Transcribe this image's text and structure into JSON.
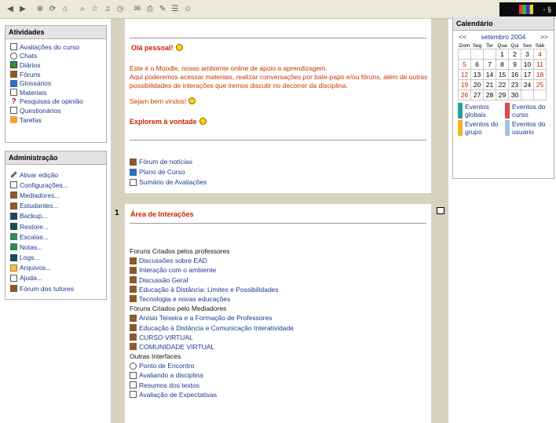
{
  "window_corner": {
    "controls": "- §"
  },
  "activities": {
    "title": "Atividades",
    "items": [
      {
        "label": "Avaliações do curso",
        "icon": "document-icon"
      },
      {
        "label": "Chats",
        "icon": "chat-icon"
      },
      {
        "label": "Diários",
        "icon": "diary-icon"
      },
      {
        "label": "Fóruns",
        "icon": "forum-icon"
      },
      {
        "label": "Glossários",
        "icon": "glossary-icon"
      },
      {
        "label": "Materiais",
        "icon": "material-icon"
      },
      {
        "label": "Pesquisas de opinião",
        "icon": "question-icon"
      },
      {
        "label": "Questionários",
        "icon": "quiz-icon"
      },
      {
        "label": "Tarefas",
        "icon": "task-icon"
      }
    ]
  },
  "admin": {
    "title": "Administração",
    "items": [
      {
        "label": "Ativar edição",
        "icon": "pen-icon"
      },
      {
        "label": "Configurações...",
        "icon": "settings-icon"
      },
      {
        "label": "Mediadores...",
        "icon": "users-icon"
      },
      {
        "label": "Estudantes...",
        "icon": "users-icon"
      },
      {
        "label": "Backup...",
        "icon": "backup-icon"
      },
      {
        "label": "Restore...",
        "icon": "restore-icon"
      },
      {
        "label": "Escalas...",
        "icon": "scales-icon"
      },
      {
        "label": "Notas...",
        "icon": "grades-icon"
      },
      {
        "label": "Logs...",
        "icon": "logs-icon"
      },
      {
        "label": "Arquivos...",
        "icon": "folder-icon"
      },
      {
        "label": "Ajuda...",
        "icon": "help-icon"
      },
      {
        "label": "Fórum dos tutores",
        "icon": "forum-icon"
      }
    ]
  },
  "intro": {
    "greeting": "Olá pessoal!",
    "paragraph1": "Este é o Moodle, nosso ambiente online de apoio a aprendizagem.",
    "paragraph2": "Aqui poderemos acessar materiais, realizar conversações por bate-papo e/ou fóruns, além de outras possibilidades de interações que iremos discutir no decorrer da disciplina.",
    "welcome": "Sejam bem vindos!",
    "explore": "Explorem à vontade",
    "links": [
      "Fórum de notícias",
      "Plano de Curso",
      "Sumário de Avaliações"
    ]
  },
  "section1": {
    "number": "1",
    "title": "Área de Interações",
    "group1_label": "Foruns Criados pelos professores",
    "group1": [
      "Discussões sobre EAD",
      "Interação com o ambiente",
      "Discussão Geral",
      "Educação à Distância: Limites e Possibilidades",
      "Tecnologia e novas educações"
    ],
    "group2_label": "Fóruns Criados pelo Mediadores",
    "group2": [
      "Anísio Teixeira e a Formação de Professores",
      "Educação à Distância e Comunicação Interatividade",
      "CURSO VIRTUAL",
      "COMUNIDADE VIRTUAL"
    ],
    "group3_label": "Outras Interfaces",
    "group3": [
      "Ponto de Encontro",
      "Avaliando a disciplina",
      "Resumos dos textos",
      "Avaliação de Expectativas"
    ]
  },
  "calendar": {
    "title": "Calendário",
    "prev": "<<",
    "next": ">>",
    "month": "setembro 2004",
    "weekdays": [
      "Dom",
      "Seg",
      "Ter",
      "Qua",
      "Qui",
      "Sex",
      "Sáb"
    ],
    "weeks": [
      [
        "",
        "",
        "",
        "1",
        "2",
        "3",
        "4"
      ],
      [
        "5",
        "6",
        "7",
        "8",
        "9",
        "10",
        "11"
      ],
      [
        "12",
        "13",
        "14",
        "15",
        "16",
        "17",
        "18"
      ],
      [
        "19",
        "20",
        "21",
        "22",
        "23",
        "24",
        "25"
      ],
      [
        "26",
        "27",
        "28",
        "29",
        "30",
        "",
        ""
      ]
    ],
    "legend": [
      {
        "label": "Eventos globais",
        "color": "#2aa198"
      },
      {
        "label": "Eventos do curso",
        "color": "#e0484a"
      },
      {
        "label": "Eventos do grupo",
        "color": "#f0b429"
      },
      {
        "label": "Eventos do usuário",
        "color": "#9cc3e6"
      }
    ]
  }
}
